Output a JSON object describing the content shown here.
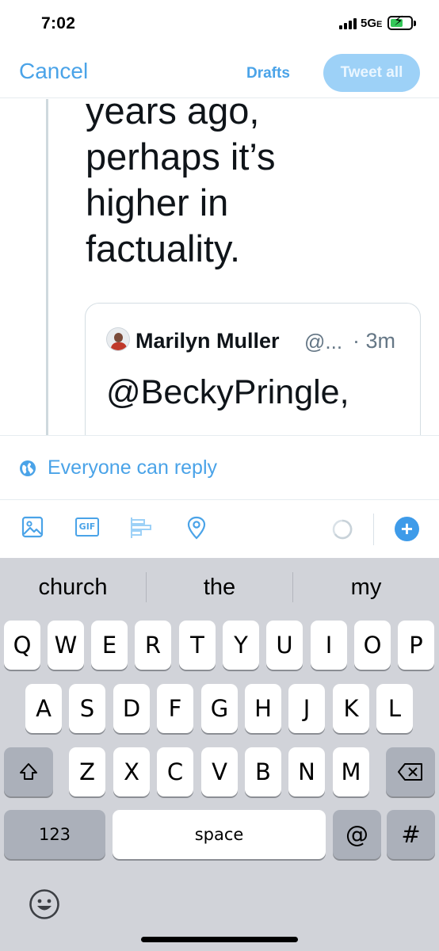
{
  "status_bar": {
    "time": "7:02",
    "network": "5G",
    "network_suffix": "E"
  },
  "header": {
    "cancel_label": "Cancel",
    "drafts_label": "Drafts",
    "tweet_all_label": "Tweet all"
  },
  "thread": {
    "lines": [
      "years ago,",
      "perhaps it’s",
      "higher in",
      "factuality."
    ],
    "quote": {
      "name": "Marilyn Muller",
      "handle": "@...",
      "time": "· 3m",
      "text": "@BeckyPringle,"
    }
  },
  "reply_settings": {
    "label": "Everyone can reply",
    "icon": "globe-icon"
  },
  "toolbar": {
    "icons": [
      "image-icon",
      "gif-icon",
      "poll-icon",
      "location-icon",
      "character-counter",
      "add-tweet-icon"
    ],
    "gif_label": "GIF",
    "add_label": "+"
  },
  "keyboard": {
    "suggestions": [
      "church",
      "the",
      "my"
    ],
    "row1": [
      "Q",
      "W",
      "E",
      "R",
      "T",
      "Y",
      "U",
      "I",
      "O",
      "P"
    ],
    "row2": [
      "A",
      "S",
      "D",
      "F",
      "G",
      "H",
      "J",
      "K",
      "L"
    ],
    "row3": [
      "Z",
      "X",
      "C",
      "V",
      "B",
      "N",
      "M"
    ],
    "bottom": {
      "numbers": "123",
      "space": "space",
      "at": "@",
      "hash": "#"
    }
  },
  "colors": {
    "accent": "#4aa3e8",
    "tweet_all_bg": "#9dd1f7",
    "keyboard_bg": "#d1d3d9",
    "battery": "#34c759"
  }
}
